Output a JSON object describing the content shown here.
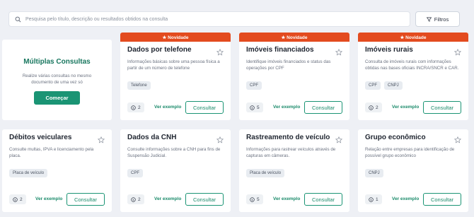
{
  "search": {
    "placeholder": "Pesquisa pelo título, descrição ou resultados obtidos na consulta"
  },
  "filters": {
    "label": "Filtros"
  },
  "multi": {
    "title": "Múltiplas Consultas",
    "description": "Realize várias consultas no mesmo documento de uma vez só",
    "button": "Começar"
  },
  "common": {
    "example_label": "Ver exemplo",
    "consult_label": "Consultar",
    "new_label": "★ Novidade"
  },
  "cards": [
    {
      "title": "Dados por telefone",
      "description": "Informações básicas sobre uma pessoa física a partir de um número de telefone",
      "tags": [
        "Telefone"
      ],
      "count": "2",
      "new": true
    },
    {
      "title": "Imóveis financiados",
      "description": "Identifique imóveis financiados e status das operações por CPF",
      "tags": [
        "CPF"
      ],
      "count": "5",
      "new": true
    },
    {
      "title": "Imóveis rurais",
      "description": "Consulta de imóveis rurais com informações obtidas nas bases oficiais INCRA/SNCR e CAR.",
      "tags": [
        "CPF",
        "CNPJ"
      ],
      "count": "2",
      "new": true
    },
    {
      "title": "Débitos veiculares",
      "description": "Consulte multas, IPVA e licenciamento pela placa.",
      "tags": [
        "Placa de veículo"
      ],
      "count": "2",
      "new": false
    },
    {
      "title": "Dados da CNH",
      "description": "Consulte informações sobre a CNH para fins de Suspensão Judicial.",
      "tags": [
        "CPF"
      ],
      "count": "2",
      "new": false
    },
    {
      "title": "Rastreamento de veículo",
      "description": "Informações para rastrear veículos através de capturas em câmeras.",
      "tags": [
        "Placa de veículo"
      ],
      "count": "5",
      "new": false
    },
    {
      "title": "Grupo econômico",
      "description": "Relação entre empresas para identificação de possível grupo econômico",
      "tags": [
        "CNPJ"
      ],
      "count": "1",
      "new": false
    }
  ],
  "colors": {
    "accent": "#1a9474",
    "new_badge": "#e34b1f"
  }
}
